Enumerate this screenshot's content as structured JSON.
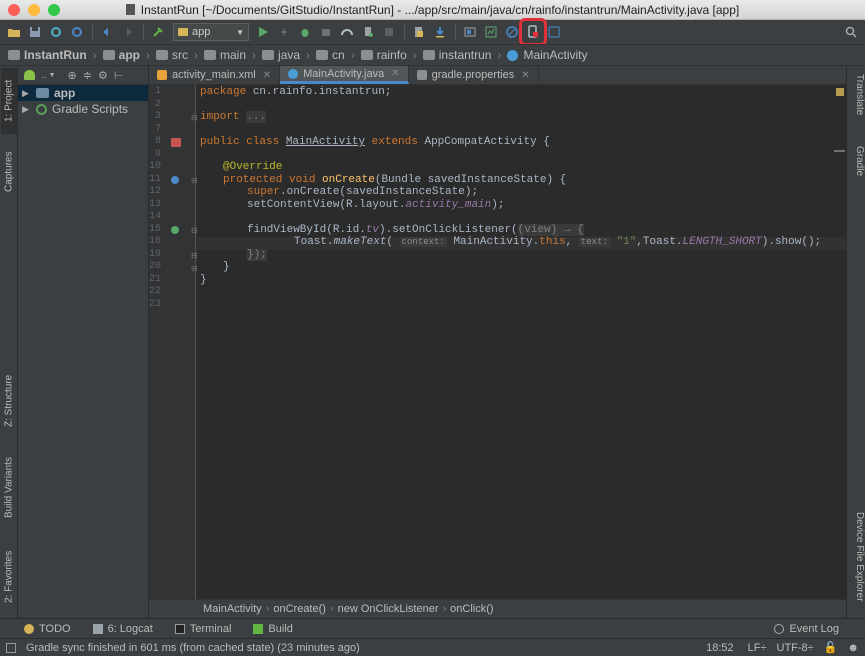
{
  "window": {
    "title": "InstantRun [~/Documents/GitStudio/InstantRun] - .../app/src/main/java/cn/rainfo/instantrun/MainActivity.java [app]"
  },
  "toolbar": {
    "run_config": "app",
    "highlighted_button": "Apply Changes"
  },
  "nav": {
    "crumbs": [
      "InstantRun",
      "app",
      "src",
      "main",
      "java",
      "cn",
      "rainfo",
      "instantrun",
      "MainActivity"
    ]
  },
  "left_tabs": {
    "project": "1: Project",
    "captures": "Captures",
    "structure": "Z: Structure",
    "build_variants": "Build Variants",
    "favorites": "2: Favorites"
  },
  "right_tabs": {
    "translate": "Translate",
    "gradle": "Gradle",
    "device_file_explorer": "Device File Explorer"
  },
  "project_panel": {
    "view_mode": "..",
    "tree": [
      {
        "label": "app",
        "selected": true
      },
      {
        "label": "Gradle Scripts",
        "selected": false
      }
    ]
  },
  "editor": {
    "tabs": [
      {
        "label": "activity_main.xml",
        "active": false,
        "icon_color": "#e8a33d"
      },
      {
        "label": "MainActivity.java",
        "active": true,
        "icon_color": "#4a9ed8"
      },
      {
        "label": "gradle.properties",
        "active": false,
        "icon_color": "#8a8f94"
      }
    ],
    "line_numbers": [
      "1",
      "2",
      "3",
      "7",
      "8",
      "9",
      "10",
      "11",
      "12",
      "13",
      "14",
      "15",
      "16",
      "19",
      "20",
      "21",
      "22",
      "23"
    ],
    "code": {
      "l1_kw": "package",
      "l1_rest": " cn.rainfo.instantrun;",
      "l3_kw": "import",
      "l3_fold": "...",
      "l8_kw": "public class",
      "l8_name": "MainActivity",
      "l8_ext": "extends",
      "l8_rest": " AppCompatActivity {",
      "l10_an": "@Override",
      "l11_kw": "protected void",
      "l11_fn": "onCreate",
      "l11_rest": "(Bundle savedInstanceState) {",
      "l12_kw": "super",
      "l12_rest": ".onCreate(savedInstanceState);",
      "l13_a": "setContentView(R.layout.",
      "l13_it": "activity_main",
      "l13_b": ");",
      "l15_a": "findViewById(R.id.",
      "l15_it": "tv",
      "l15_b": ").setOnClickListener(",
      "l15_lam": "(view) → {",
      "l16_a": "Toast.",
      "l16_mk": "makeText",
      "l16_b": "( ",
      "l16_hint1": "context:",
      "l16_c": " MainActivity.",
      "l16_this": "this",
      "l16_d": ", ",
      "l16_hint2": "text:",
      "l16_str": "\"1\"",
      "l16_e": ",Toast.",
      "l16_len": "LENGTH_SHORT",
      "l16_f": ").show();",
      "l19": "});",
      "l20": "}",
      "l21": "}"
    },
    "bottom_breadcrumb": [
      "MainActivity",
      "onCreate()",
      "new OnClickListener",
      "onClick()"
    ]
  },
  "bottom_tools": {
    "todo": "TODO",
    "logcat": "6: Logcat",
    "terminal": "Terminal",
    "build": "Build",
    "event_log": "Event Log"
  },
  "status": {
    "message": "Gradle sync finished in 601 ms (from cached state) (23 minutes ago)",
    "position": "18:52",
    "line_sep": "LF÷",
    "encoding": "UTF-8÷"
  }
}
